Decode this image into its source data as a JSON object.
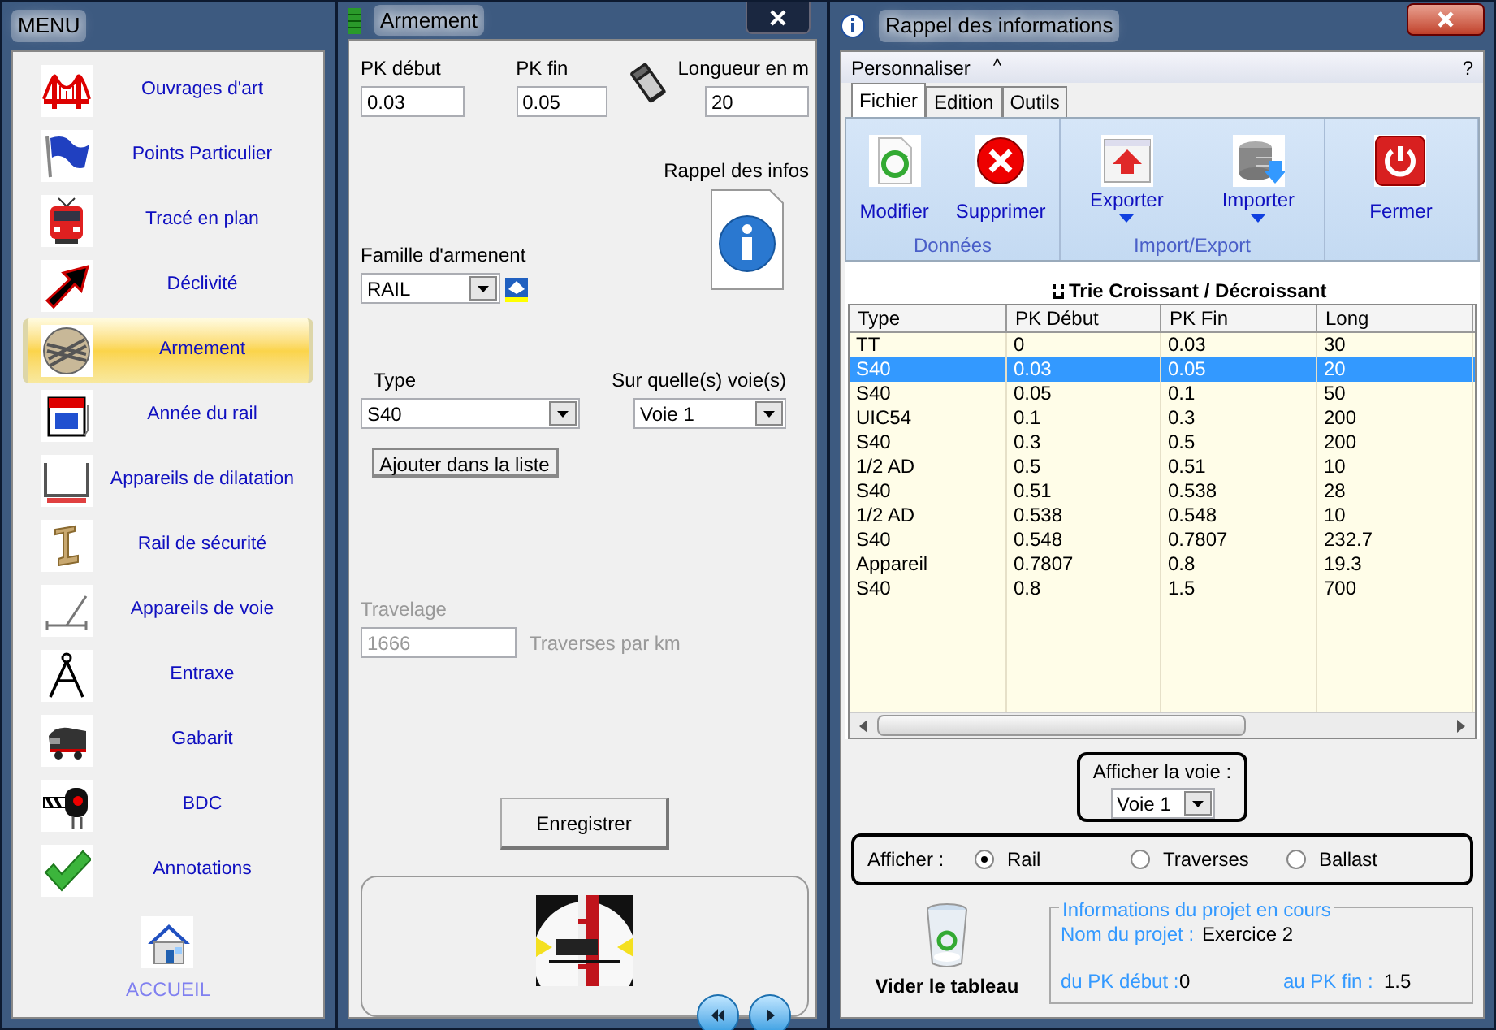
{
  "menu": {
    "title": "MENU",
    "items": [
      {
        "label": "Ouvrages d'art",
        "kind": "bridge",
        "selected": false
      },
      {
        "label": "Points Particulier",
        "kind": "flag",
        "selected": false
      },
      {
        "label": "Tracé en plan",
        "kind": "train",
        "selected": false
      },
      {
        "label": "Déclivité",
        "kind": "arrow",
        "selected": false
      },
      {
        "label": "Armement",
        "kind": "rails",
        "selected": true
      },
      {
        "label": "Année du rail",
        "kind": "calendar",
        "selected": false
      },
      {
        "label": "Appareils de dilatation",
        "kind": "bracket",
        "selected": false
      },
      {
        "label": "Rail de sécurité",
        "kind": "beam",
        "selected": false
      },
      {
        "label": "Appareils de voie",
        "kind": "switch",
        "selected": false
      },
      {
        "label": "Entraxe",
        "kind": "compass",
        "selected": false
      },
      {
        "label": "Gabarit",
        "kind": "locomotive",
        "selected": false
      },
      {
        "label": "BDC",
        "kind": "signal",
        "selected": false
      },
      {
        "label": "Annotations",
        "kind": "check",
        "selected": false
      }
    ],
    "home": "ACCUEIL"
  },
  "armement": {
    "title": "Armement",
    "pk_debut": {
      "label": "PK début",
      "value": "0.03"
    },
    "pk_fin": {
      "label": "PK fin",
      "value": "0.05"
    },
    "longueur": {
      "label": "Longueur en m",
      "value": "20"
    },
    "rappel_label": "Rappel des infos",
    "famille": {
      "label": "Famille d'armenent",
      "value": "RAIL"
    },
    "type": {
      "label": "Type",
      "value": "S40"
    },
    "voies": {
      "label": "Sur quelle(s) voie(s)",
      "value": "Voie 1"
    },
    "add_button": "Ajouter dans la liste",
    "travelage": {
      "label": "Travelage",
      "value": "1666",
      "unit": "Traverses par km",
      "disabled": true
    },
    "save_button": "Enregistrer"
  },
  "rappel": {
    "title": "Rappel des informations",
    "ribbon": {
      "menu": "Personnaliser",
      "collapse": "^",
      "help": "?",
      "tabs": [
        {
          "label": "Fichier",
          "selected": true
        },
        {
          "label": "Edition",
          "selected": false
        },
        {
          "label": "Outils",
          "selected": false
        }
      ],
      "groups": [
        {
          "label": "Données",
          "buttons": [
            {
              "label": "Modifier",
              "kind": "recycle",
              "dropdown": false
            },
            {
              "label": "Supprimer",
              "kind": "delete",
              "dropdown": false
            }
          ]
        },
        {
          "label": "Import/Export",
          "buttons": [
            {
              "label": "Exporter",
              "kind": "export",
              "dropdown": true
            },
            {
              "label": "Importer",
              "kind": "import",
              "dropdown": true
            }
          ]
        },
        {
          "buttons": [
            {
              "label": "Fermer",
              "kind": "power",
              "dropdown": false
            }
          ]
        }
      ]
    },
    "sort_label": "Trie Croissant / Décroissant",
    "table": {
      "columns": [
        "Type",
        "PK Début",
        "PK Fin",
        "Long"
      ],
      "rows": [
        {
          "cells": [
            "TT",
            "0",
            "0.03",
            "30"
          ],
          "selected": false
        },
        {
          "cells": [
            "S40",
            "0.03",
            "0.05",
            "20"
          ],
          "selected": true
        },
        {
          "cells": [
            "S40",
            "0.05",
            "0.1",
            "50"
          ],
          "selected": false
        },
        {
          "cells": [
            "UIC54",
            "0.1",
            "0.3",
            "200"
          ],
          "selected": false
        },
        {
          "cells": [
            "S40",
            "0.3",
            "0.5",
            "200"
          ],
          "selected": false
        },
        {
          "cells": [
            "1/2 AD",
            "0.5",
            "0.51",
            "10"
          ],
          "selected": false
        },
        {
          "cells": [
            "S40",
            "0.51",
            "0.538",
            "28"
          ],
          "selected": false
        },
        {
          "cells": [
            "1/2 AD",
            "0.538",
            "0.548",
            "10"
          ],
          "selected": false
        },
        {
          "cells": [
            "S40",
            "0.548",
            "0.7807",
            "232.7"
          ],
          "selected": false
        },
        {
          "cells": [
            "Appareil",
            "0.7807",
            "0.8",
            "19.3"
          ],
          "selected": false
        },
        {
          "cells": [
            "S40",
            "0.8",
            "1.5",
            "700"
          ],
          "selected": false
        }
      ]
    },
    "voie": {
      "label": "Afficher la voie :",
      "value": "Voie 1"
    },
    "afficher": {
      "label": "Afficher :",
      "options": [
        {
          "label": "Rail",
          "selected": true
        },
        {
          "label": "Traverses",
          "selected": false
        },
        {
          "label": "Ballast",
          "selected": false
        }
      ]
    },
    "clear_label": "Vider le tableau",
    "project": {
      "legend": "Informations du projet en cours",
      "name_label": "Nom du projet :",
      "name": "Exercice 2",
      "start_label": "du PK début :",
      "start": "0",
      "end_label": "au PK fin :",
      "end": "1.5"
    }
  }
}
